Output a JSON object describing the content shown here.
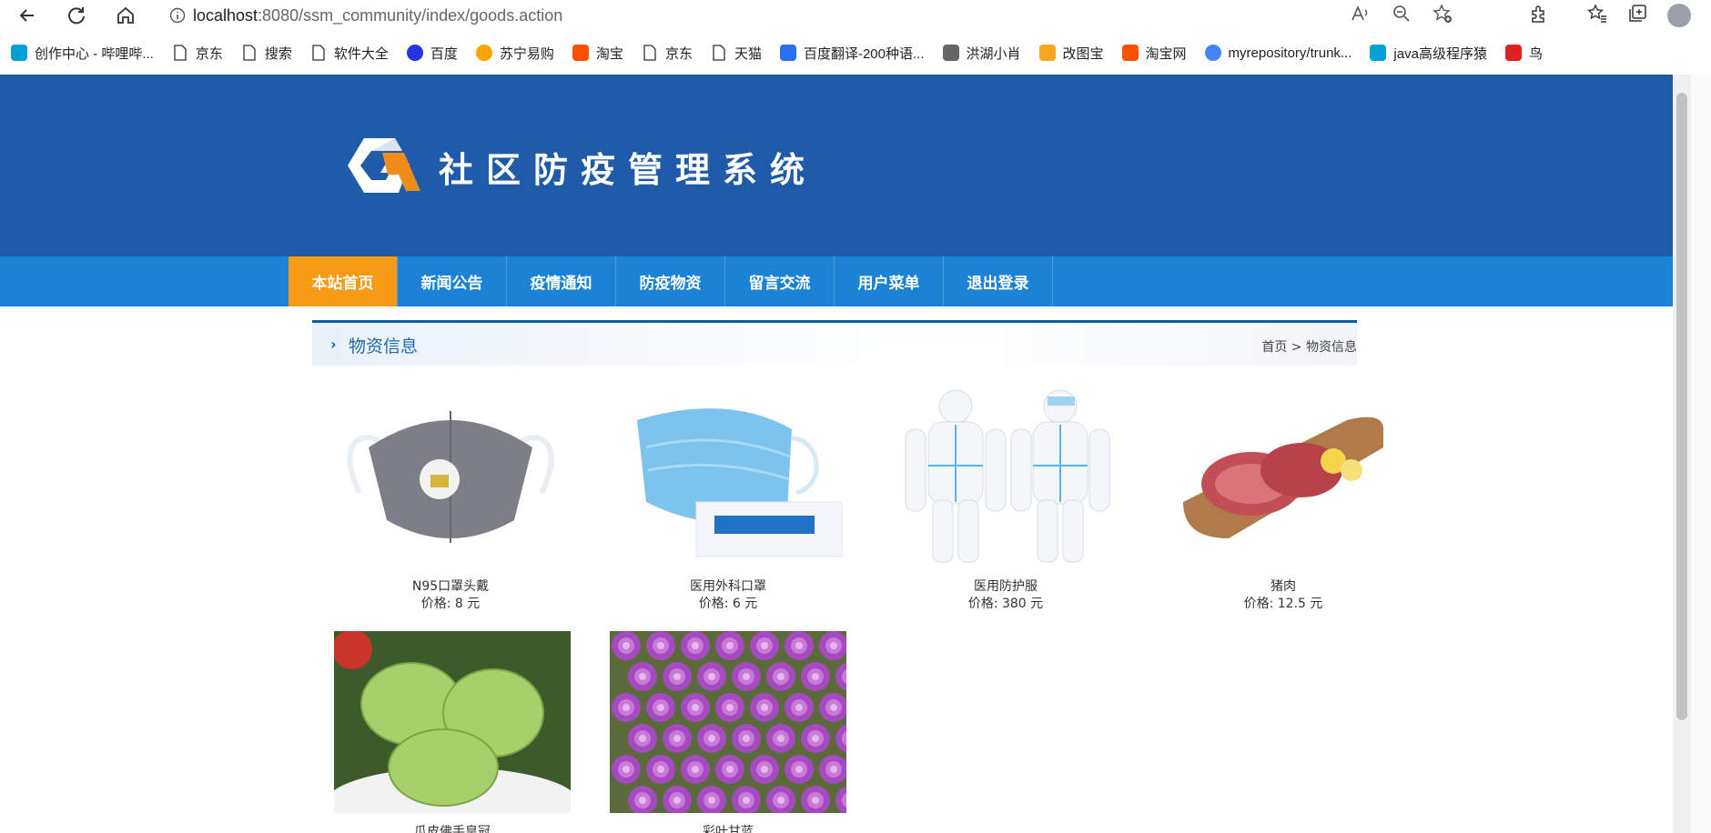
{
  "browser": {
    "url_host": "localhost",
    "url_rest": ":8080/ssm_community/index/goods.action"
  },
  "bookmarks": [
    {
      "label": "创作中心 - 哔哩哔...",
      "icon": "bilibili-icon",
      "color": "#00a1d6"
    },
    {
      "label": "京东",
      "icon": "page-icon",
      "color": ""
    },
    {
      "label": "搜索",
      "icon": "page-icon",
      "color": ""
    },
    {
      "label": "软件大全",
      "icon": "page-icon",
      "color": ""
    },
    {
      "label": "百度",
      "icon": "baidu-icon",
      "color": "#2932e1"
    },
    {
      "label": "苏宁易购",
      "icon": "suning-icon",
      "color": "#f7a400"
    },
    {
      "label": "淘宝",
      "icon": "taobao-icon",
      "color": "#ff5000"
    },
    {
      "label": "京东",
      "icon": "page-icon",
      "color": ""
    },
    {
      "label": "天猫",
      "icon": "page-icon",
      "color": ""
    },
    {
      "label": "百度翻译-200种语...",
      "icon": "translate-icon",
      "color": "#2b6ff6"
    },
    {
      "label": "洪湖小肖",
      "icon": "bird-icon",
      "color": "#666666"
    },
    {
      "label": "改图宝",
      "icon": "gaitubao-icon",
      "color": "#f5a623"
    },
    {
      "label": "淘宝网",
      "icon": "taobao-icon",
      "color": "#ff5000"
    },
    {
      "label": "myrepository/trunk...",
      "icon": "chrome-icon",
      "color": "#4285f4"
    },
    {
      "label": "java高级程序猿",
      "icon": "bilibili-icon",
      "color": "#00a1d6"
    },
    {
      "label": "鸟",
      "icon": "bird-icon",
      "color": "#e02020"
    }
  ],
  "site": {
    "title": "社区防疫管理系统",
    "brand_color": "#1f5ba8",
    "nav_color": "#1c82d6",
    "active_color": "#f79a14"
  },
  "nav": [
    {
      "label": "本站首页",
      "active": true
    },
    {
      "label": "新闻公告",
      "active": false
    },
    {
      "label": "疫情通知",
      "active": false
    },
    {
      "label": "防疫物资",
      "active": false
    },
    {
      "label": "留言交流",
      "active": false
    },
    {
      "label": "用户菜单",
      "active": false
    },
    {
      "label": "退出登录",
      "active": false
    }
  ],
  "section": {
    "title": "物资信息",
    "breadcrumb": "首页 >  物资信息"
  },
  "goods": [
    {
      "name": "N95口罩头戴",
      "price": "价格: 8 元",
      "image": "n95-mask-image"
    },
    {
      "name": "医用外科口罩",
      "price": "价格: 6 元",
      "image": "surgical-mask-image"
    },
    {
      "name": "医用防护服",
      "price": "价格: 380 元",
      "image": "protective-suit-image"
    },
    {
      "name": "猪肉",
      "price": "价格: 12.5 元",
      "image": "pork-image"
    },
    {
      "name": "瓜皮佛手皇冠",
      "price": "",
      "image": "chayote-image"
    },
    {
      "name": "彩叶甘蓝",
      "price": "",
      "image": "kale-image"
    }
  ]
}
